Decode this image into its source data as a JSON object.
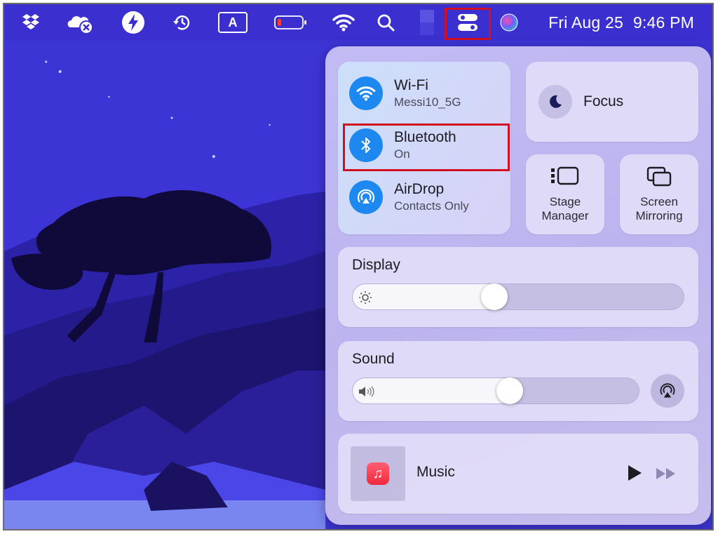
{
  "menubar": {
    "icons": [
      "dropbox-icon",
      "icloud-offline-icon",
      "amphetamine-icon",
      "time-machine-icon",
      "input-source-icon",
      "battery-icon",
      "wifi-icon",
      "spotlight-icon",
      "menu-extra-icon",
      "control-center-icon",
      "siri-icon"
    ],
    "input_source_letter": "A",
    "clock_date": "Fri Aug 25",
    "clock_time": "9:46 PM"
  },
  "control_center": {
    "wifi": {
      "title": "Wi-Fi",
      "subtitle": "Messi10_5G"
    },
    "bluetooth": {
      "title": "Bluetooth",
      "subtitle": "On"
    },
    "airdrop": {
      "title": "AirDrop",
      "subtitle": "Contacts Only"
    },
    "focus": {
      "label": "Focus"
    },
    "stage_manager": {
      "line1": "Stage",
      "line2": "Manager"
    },
    "screen_mirroring": {
      "line1": "Screen",
      "line2": "Mirroring"
    },
    "display": {
      "title": "Display",
      "brightness_fraction": 0.42
    },
    "sound": {
      "title": "Sound",
      "volume_fraction": 0.55
    },
    "music": {
      "label": "Music"
    }
  },
  "colors": {
    "accent_blue": "#1d88f0",
    "highlight_red": "#d01020",
    "wallpaper": "#3b30cf"
  }
}
